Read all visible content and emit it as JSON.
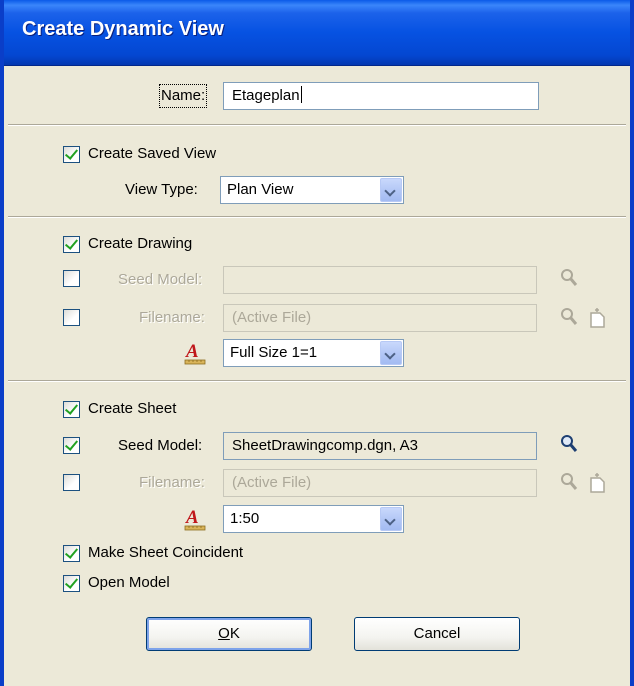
{
  "dialog": {
    "title": "Create Dynamic View"
  },
  "name_row": {
    "label": "Name:",
    "value": "Etageplan"
  },
  "saved_view": {
    "checkbox_label": "Create Saved View",
    "checked": true,
    "view_type_label": "View Type:",
    "view_type_value": "Plan View"
  },
  "drawing": {
    "checkbox_label": "Create Drawing",
    "checked": true,
    "seed_model_label": "Seed Model:",
    "seed_model_value": "",
    "seed_model_checked": false,
    "filename_label": "Filename:",
    "filename_value": "(Active File)",
    "filename_checked": false,
    "annotation_scale_value": "Full Size 1=1"
  },
  "sheet": {
    "checkbox_label": "Create Sheet",
    "checked": true,
    "seed_model_label": "Seed Model:",
    "seed_model_value": "SheetDrawingcomp.dgn, A3",
    "seed_model_checked": true,
    "filename_label": "Filename:",
    "filename_value": "(Active File)",
    "filename_checked": false,
    "annotation_scale_value": "1:50"
  },
  "options": {
    "make_coincident_label": "Make Sheet Coincident",
    "make_coincident_checked": true,
    "open_model_label": "Open Model",
    "open_model_checked": true
  },
  "buttons": {
    "ok_mnemonic": "O",
    "ok_rest": "K",
    "cancel_label": "Cancel"
  },
  "colors": {
    "titlebar": "#0a5ae8",
    "dialog_bg": "#ece9d8",
    "check_green": "#21a121"
  },
  "icons": {
    "browse": "magnifier-icon",
    "new_file": "new-file-icon",
    "annotation_scale": "annotation-scale-icon"
  }
}
